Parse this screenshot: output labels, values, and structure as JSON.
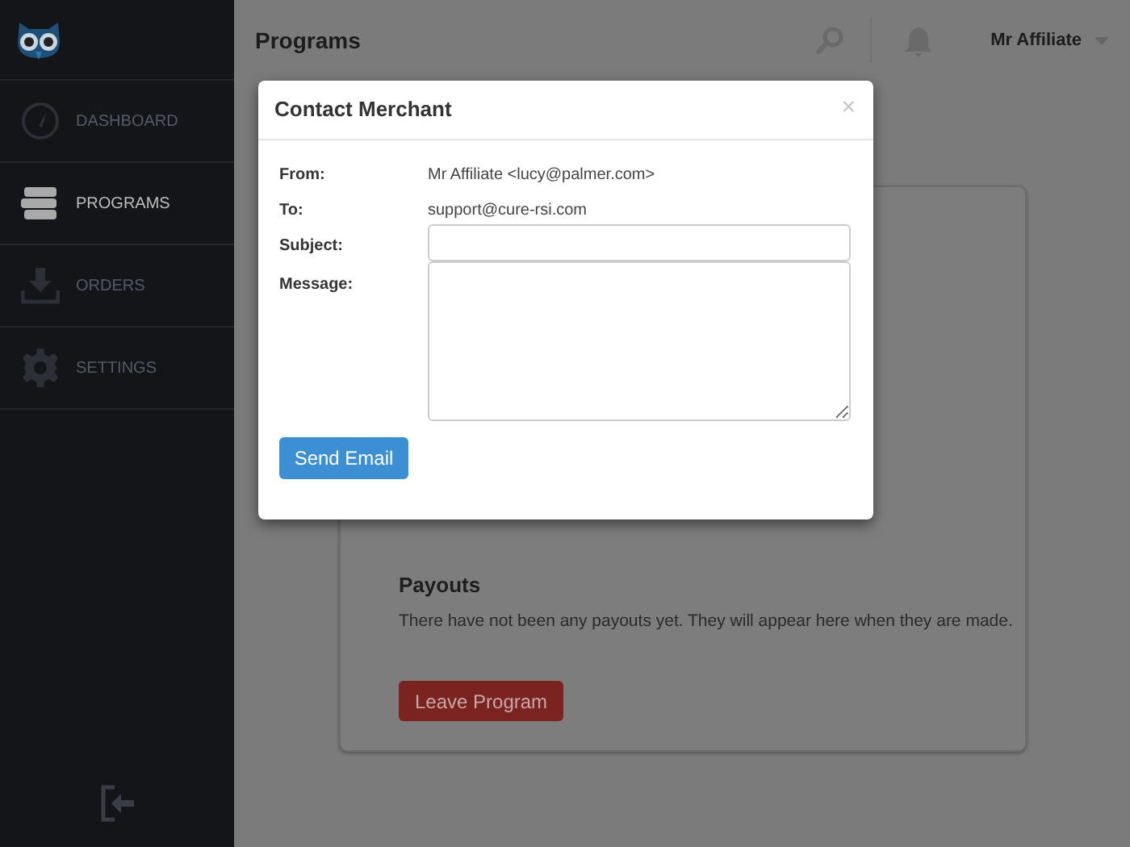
{
  "sidebar": {
    "items": [
      {
        "label": "DASHBOARD",
        "selected": false
      },
      {
        "label": "PROGRAMS",
        "selected": true
      },
      {
        "label": "ORDERS",
        "selected": false
      },
      {
        "label": "SETTINGS",
        "selected": false
      }
    ]
  },
  "header": {
    "title": "Programs",
    "user": "Mr Affiliate"
  },
  "card": {
    "payouts_title": "Payouts",
    "payouts_text": "There have not been any payouts yet. They will appear here when they are made.",
    "leave_button": "Leave Program"
  },
  "modal": {
    "title": "Contact Merchant",
    "close": "×",
    "fields": [
      {
        "kind": "text",
        "label": "From:",
        "value": "Mr Affiliate <lucy@palmer.com>"
      },
      {
        "kind": "text",
        "label": "To:",
        "value": "support@cure-rsi.com"
      },
      {
        "kind": "input",
        "label": "Subject:"
      },
      {
        "kind": "textarea",
        "label": "Message:"
      }
    ],
    "send_button": "Send Email"
  }
}
